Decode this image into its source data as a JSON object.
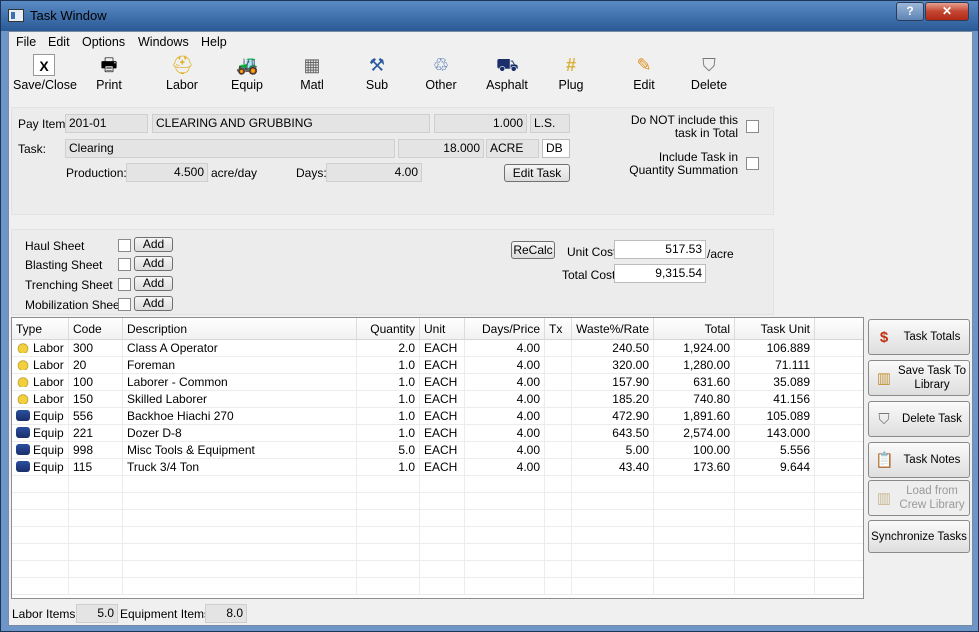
{
  "window": {
    "title": "Task Window",
    "help_label": "?",
    "close_label": "✕"
  },
  "menu": [
    "File",
    "Edit",
    "Options",
    "Windows",
    "Help"
  ],
  "toolbar": [
    {
      "label": "Save/Close",
      "icon": "save-close-icon"
    },
    {
      "label": "Print",
      "icon": "printer-icon"
    },
    {
      "label": "Labor",
      "icon": "hardhat-icon"
    },
    {
      "label": "Equip",
      "icon": "equipment-icon"
    },
    {
      "label": "Matl",
      "icon": "materials-icon"
    },
    {
      "label": "Sub",
      "icon": "subcontractor-icon"
    },
    {
      "label": "Other",
      "icon": "other-icon"
    },
    {
      "label": "Asphalt",
      "icon": "asphalt-icon"
    },
    {
      "label": "Plug",
      "icon": "plug-icon"
    },
    {
      "label": "Edit",
      "icon": "pencil-icon"
    },
    {
      "label": "Delete",
      "icon": "delete-icon"
    }
  ],
  "pay_item": {
    "label": "Pay Item:",
    "code": "201-01",
    "description": "CLEARING AND GRUBBING",
    "quantity": "1.000",
    "unit": "L.S."
  },
  "task": {
    "label": "Task:",
    "name": "Clearing",
    "quantity": "18.000",
    "unit": "ACRE",
    "code": "DB"
  },
  "production": {
    "label": "Production:",
    "value": "4.500",
    "unit": "acre/day"
  },
  "days": {
    "label": "Days:",
    "value": "4.00"
  },
  "edit_task_label": "Edit Task",
  "options": {
    "exclude_label": "Do NOT include this task in Total",
    "include_qty_label": "Include Task in Quantity Summation"
  },
  "sheets": [
    {
      "label": "Haul Sheet",
      "add": "Add"
    },
    {
      "label": "Blasting Sheet",
      "add": "Add"
    },
    {
      "label": "Trenching Sheet",
      "add": "Add"
    },
    {
      "label": "Mobilization Sheet",
      "add": "Add"
    }
  ],
  "recalc_label": "ReCalc",
  "unit_cost": {
    "label": "Unit Cost:",
    "value": "517.53",
    "suffix": "/acre"
  },
  "total_cost": {
    "label": "Total Cost:",
    "value": "9,315.54"
  },
  "grid": {
    "columns": [
      "Type",
      "Code",
      "Description",
      "Quantity",
      "Unit",
      "Days/Price",
      "Tx",
      "Waste%/Rate",
      "Total",
      "Task Unit"
    ],
    "rows": [
      {
        "type": "Labor",
        "code": "300",
        "desc": "Class A Operator",
        "qty": "2.0",
        "unit": "EACH",
        "days": "4.00",
        "tx": "",
        "rate": "240.50",
        "total": "1,924.00",
        "task_unit": "106.889"
      },
      {
        "type": "Labor",
        "code": "20",
        "desc": "Foreman",
        "qty": "1.0",
        "unit": "EACH",
        "days": "4.00",
        "tx": "",
        "rate": "320.00",
        "total": "1,280.00",
        "task_unit": "71.111"
      },
      {
        "type": "Labor",
        "code": "100",
        "desc": "Laborer - Common",
        "qty": "1.0",
        "unit": "EACH",
        "days": "4.00",
        "tx": "",
        "rate": "157.90",
        "total": "631.60",
        "task_unit": "35.089"
      },
      {
        "type": "Labor",
        "code": "150",
        "desc": "Skilled Laborer",
        "qty": "1.0",
        "unit": "EACH",
        "days": "4.00",
        "tx": "",
        "rate": "185.20",
        "total": "740.80",
        "task_unit": "41.156"
      },
      {
        "type": "Equip",
        "code": "556",
        "desc": "Backhoe Hiachi 270",
        "qty": "1.0",
        "unit": "EACH",
        "days": "4.00",
        "tx": "",
        "rate": "472.90",
        "total": "1,891.60",
        "task_unit": "105.089"
      },
      {
        "type": "Equip",
        "code": "221",
        "desc": "Dozer D-8",
        "qty": "1.0",
        "unit": "EACH",
        "days": "4.00",
        "tx": "",
        "rate": "643.50",
        "total": "2,574.00",
        "task_unit": "143.000"
      },
      {
        "type": "Equip",
        "code": "998",
        "desc": "Misc Tools & Equipment",
        "qty": "5.0",
        "unit": "EACH",
        "days": "4.00",
        "tx": "",
        "rate": "5.00",
        "total": "100.00",
        "task_unit": "5.556"
      },
      {
        "type": "Equip",
        "code": "115",
        "desc": "Truck 3/4 Ton",
        "qty": "1.0",
        "unit": "EACH",
        "days": "4.00",
        "tx": "",
        "rate": "43.40",
        "total": "173.60",
        "task_unit": "9.644"
      }
    ]
  },
  "side_buttons": [
    {
      "label": "Task Totals",
      "icon": "dollar-icon",
      "enabled": true
    },
    {
      "label": "Save Task To Library",
      "icon": "library-save-icon",
      "enabled": true
    },
    {
      "label": "Delete Task",
      "icon": "delete-icon",
      "enabled": true
    },
    {
      "label": "Task Notes",
      "icon": "clipboard-icon",
      "enabled": true
    },
    {
      "label": "Load from Crew Library",
      "icon": "library-load-icon",
      "enabled": false
    },
    {
      "label": "Synchronize Tasks",
      "icon": "",
      "enabled": true
    }
  ],
  "status": {
    "labor_label": "Labor Items:",
    "labor_value": "5.0",
    "equip_label": "Equipment Items:",
    "equip_value": "8.0"
  }
}
